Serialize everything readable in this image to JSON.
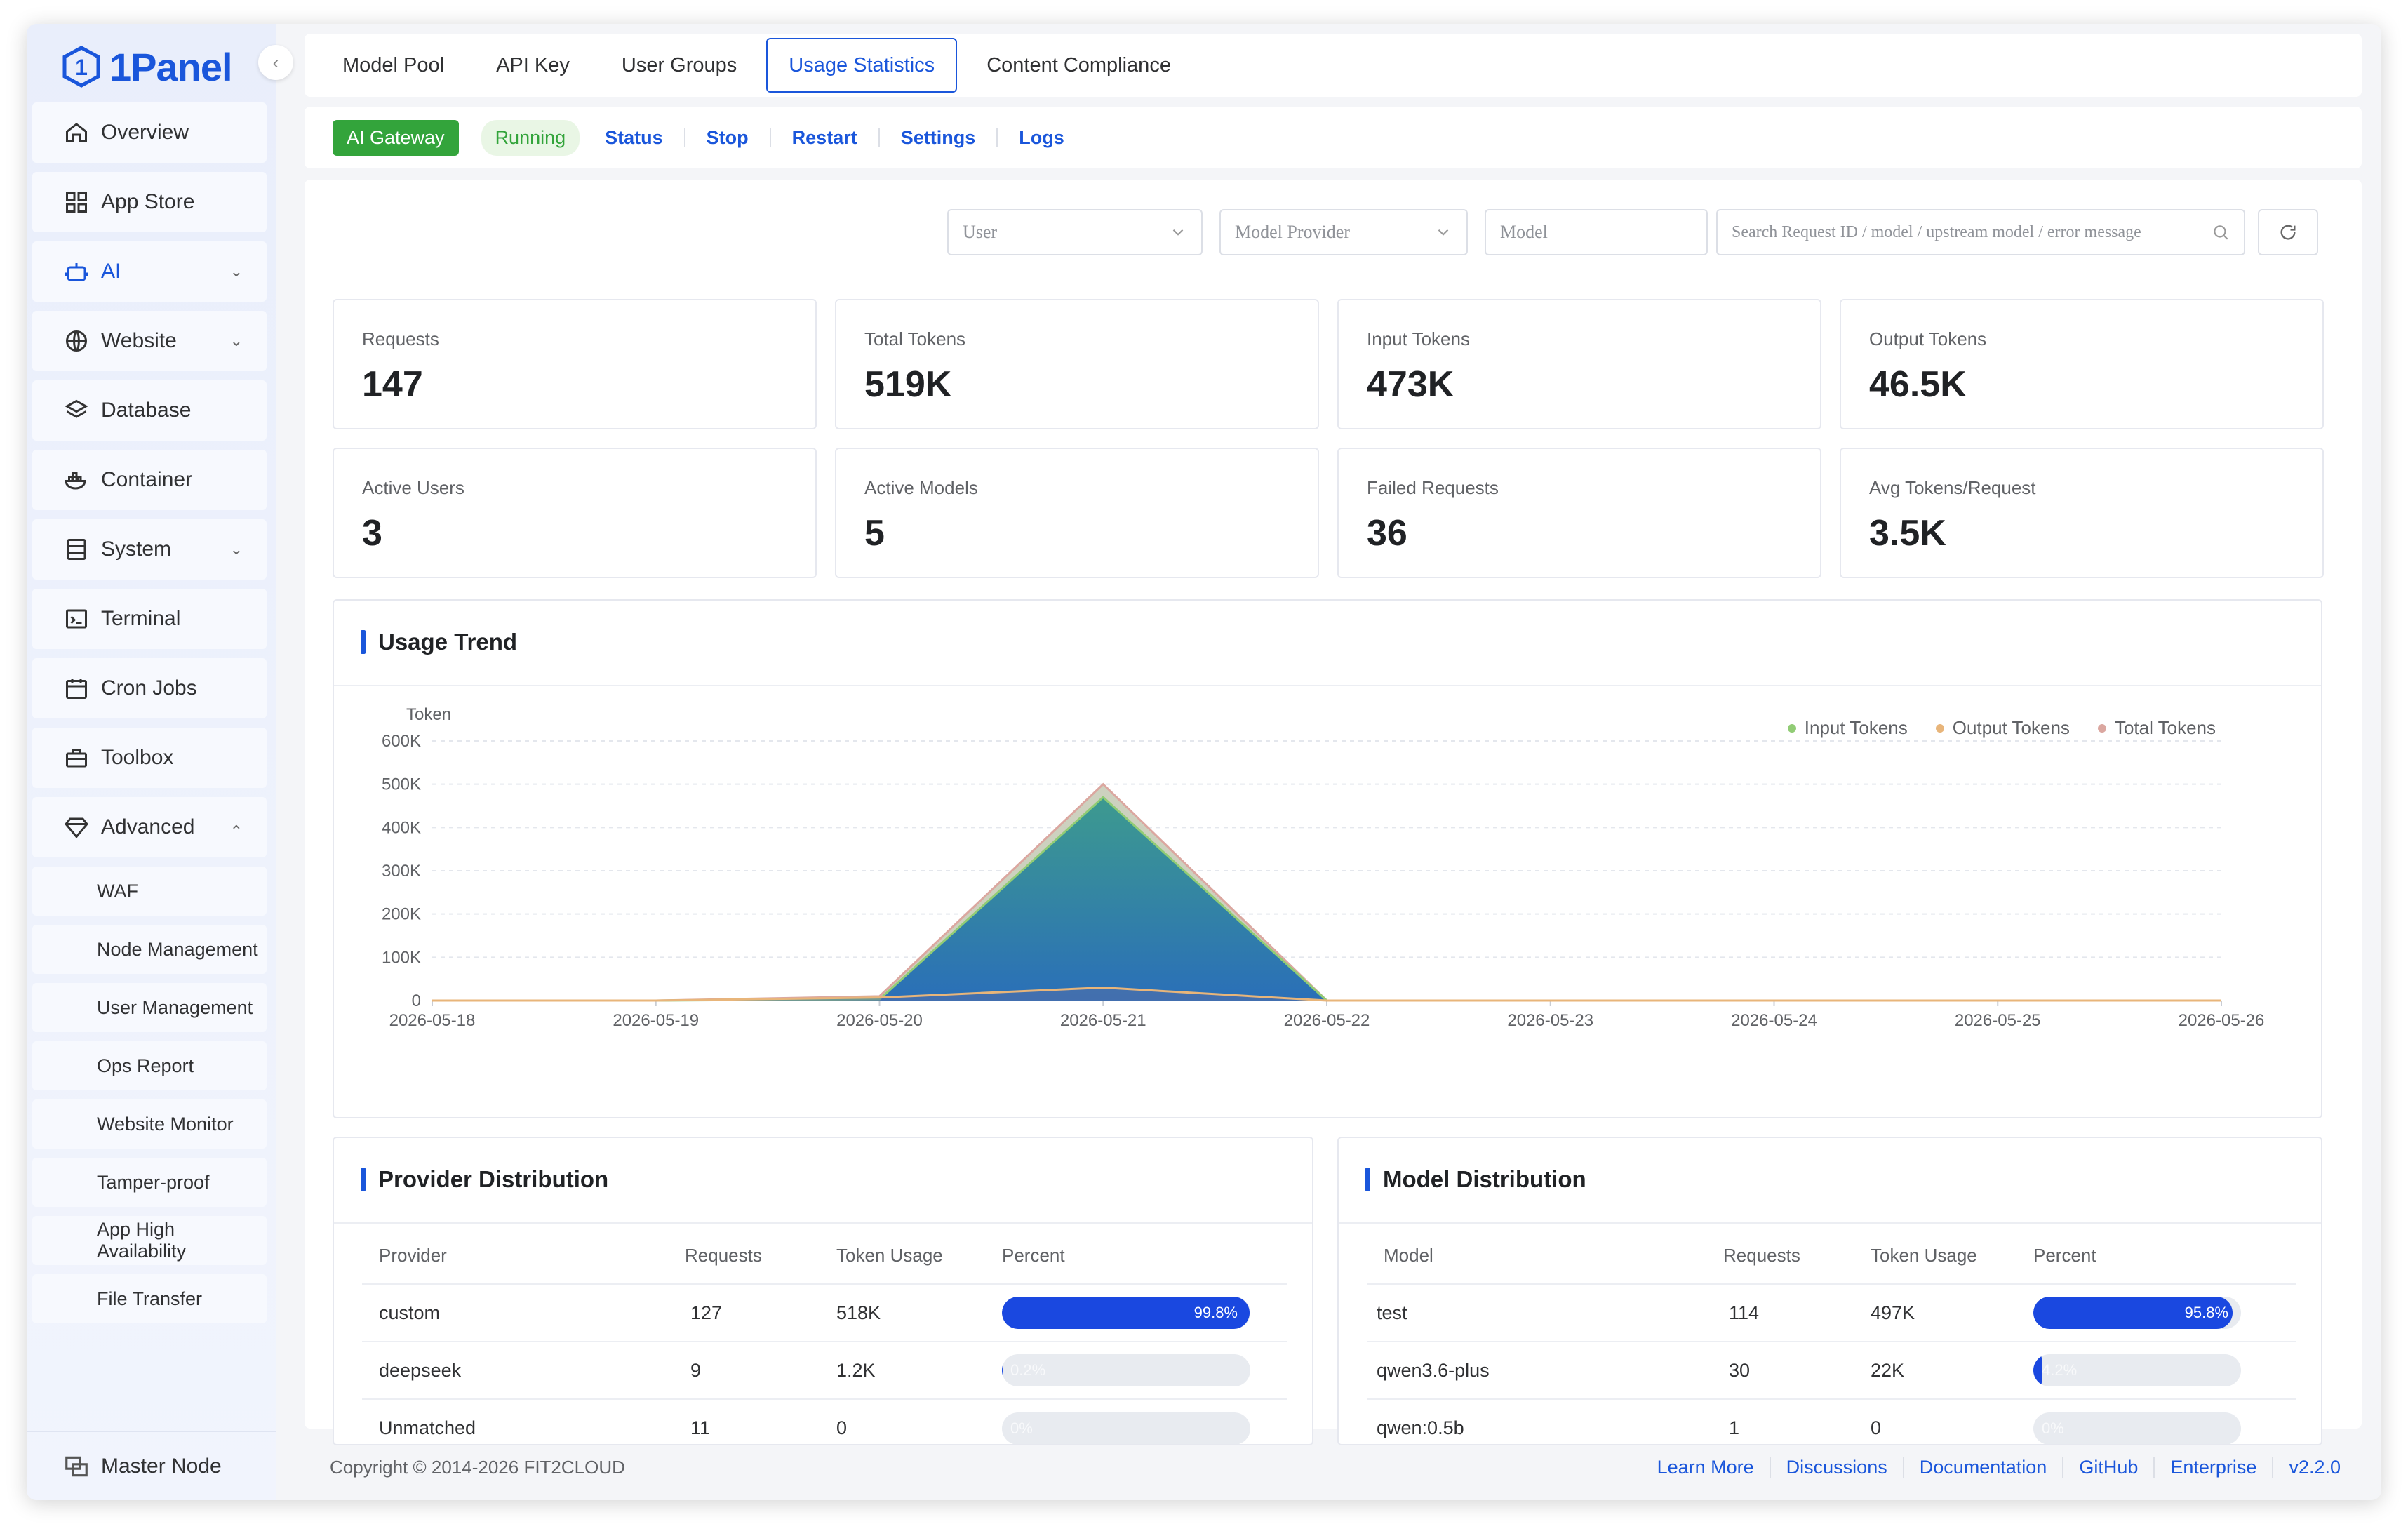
{
  "brand": {
    "name": "1Panel"
  },
  "sidebar": {
    "items": [
      {
        "label": "Overview",
        "icon": "home-icon"
      },
      {
        "label": "App Store",
        "icon": "grid-icon"
      },
      {
        "label": "AI",
        "icon": "robot-icon"
      },
      {
        "label": "Website",
        "icon": "globe-icon"
      },
      {
        "label": "Database",
        "icon": "layers-icon"
      },
      {
        "label": "Container",
        "icon": "whale-icon"
      },
      {
        "label": "System",
        "icon": "server-icon"
      },
      {
        "label": "Terminal",
        "icon": "terminal-icon"
      },
      {
        "label": "Cron Jobs",
        "icon": "calendar-icon"
      },
      {
        "label": "Toolbox",
        "icon": "toolbox-icon"
      },
      {
        "label": "Advanced",
        "icon": "diamond-icon"
      }
    ],
    "advanced_items": [
      "WAF",
      "Node Management",
      "User Management",
      "Ops Report",
      "Website Monitor",
      "Tamper-proof",
      "App High Availability",
      "File Transfer"
    ],
    "master": "Master Node"
  },
  "tabs": [
    "Model Pool",
    "API Key",
    "User Groups",
    "Usage Statistics",
    "Content Compliance"
  ],
  "app": {
    "name": "AI Gateway",
    "status": "Running",
    "actions": [
      "Status",
      "Stop",
      "Restart",
      "Settings",
      "Logs"
    ]
  },
  "filters": {
    "user": "User",
    "provider": "Model Provider",
    "model": "Model",
    "search": "Search Request ID / model / upstream model / error message"
  },
  "stats": [
    {
      "label": "Requests",
      "value": "147"
    },
    {
      "label": "Total Tokens",
      "value": "519K"
    },
    {
      "label": "Input Tokens",
      "value": "473K"
    },
    {
      "label": "Output Tokens",
      "value": "46.5K"
    },
    {
      "label": "Active Users",
      "value": "3"
    },
    {
      "label": "Active Models",
      "value": "5"
    },
    {
      "label": "Failed Requests",
      "value": "36"
    },
    {
      "label": "Avg Tokens/Request",
      "value": "3.5K"
    }
  ],
  "chart_data": {
    "type": "area",
    "title": "Usage Trend",
    "ylabel": "Token",
    "ylim": [
      0,
      600000
    ],
    "yticks": [
      "0",
      "100K",
      "200K",
      "300K",
      "400K",
      "500K",
      "600K"
    ],
    "x": [
      "2026-05-18",
      "2026-05-19",
      "2026-05-20",
      "2026-05-21",
      "2026-05-22",
      "2026-05-23",
      "2026-05-24",
      "2026-05-25",
      "2026-05-26"
    ],
    "series": [
      {
        "name": "Input Tokens",
        "color": "#91cc75",
        "values": [
          0,
          0,
          3000,
          470000,
          0,
          0,
          0,
          0,
          0
        ]
      },
      {
        "name": "Output Tokens",
        "color": "#e8b57a",
        "values": [
          0,
          0,
          7000,
          30000,
          0,
          0,
          0,
          0,
          0
        ]
      },
      {
        "name": "Total Tokens",
        "color": "#dba7a0",
        "values": [
          0,
          0,
          10000,
          500000,
          0,
          0,
          0,
          0,
          0
        ]
      }
    ],
    "grid": true,
    "legend": "top-right"
  },
  "provider": {
    "title": "Provider Distribution",
    "headers": [
      "Provider",
      "Requests",
      "Token Usage",
      "Percent"
    ],
    "rows": [
      {
        "name": "custom",
        "requests": "127",
        "tokens": "518K",
        "percent": "99.8%",
        "frac": 0.998
      },
      {
        "name": "deepseek",
        "requests": "9",
        "tokens": "1.2K",
        "percent": "0.2%",
        "frac": 0.002
      },
      {
        "name": "Unmatched",
        "requests": "11",
        "tokens": "0",
        "percent": "0%",
        "frac": 0
      }
    ]
  },
  "model": {
    "title": "Model Distribution",
    "headers": [
      "Model",
      "Requests",
      "Token Usage",
      "Percent"
    ],
    "rows": [
      {
        "name": "test",
        "requests": "114",
        "tokens": "497K",
        "percent": "95.8%",
        "frac": 0.958
      },
      {
        "name": "qwen3.6-plus",
        "requests": "30",
        "tokens": "22K",
        "percent": "4.2%",
        "frac": 0.042
      },
      {
        "name": "qwen:0.5b",
        "requests": "1",
        "tokens": "0",
        "percent": "0%",
        "frac": 0
      }
    ]
  },
  "footer": {
    "copyright": "Copyright © 2014-2026 FIT2CLOUD",
    "links": [
      "Learn More",
      "Discussions",
      "Documentation",
      "GitHub",
      "Enterprise"
    ],
    "version": "v2.2.0"
  },
  "colors": {
    "primary": "#1a56db",
    "success": "#33a43b"
  }
}
